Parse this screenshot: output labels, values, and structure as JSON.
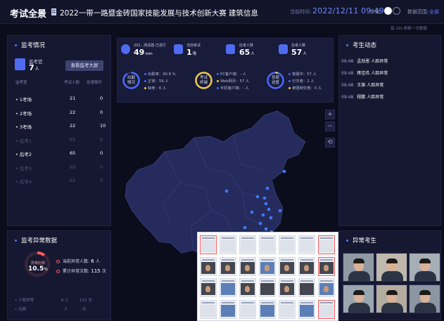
{
  "header": {
    "title": "考试全景",
    "subtitle": "2022一带一路暨金砖国家技能发展与技术创新大赛 建筑信息",
    "time_label": "当前时间:",
    "time": "2022/12/11 09:49",
    "theme_label": "外观:",
    "range_label": "数据范围:",
    "range_link": "全部",
    "refresh_note": "每 10s 刷新一次数据"
  },
  "proctor_panel": {
    "title": "监考情况",
    "proctor_label": "监考官",
    "proctor_count": "7",
    "proctor_unit": "人",
    "wall_button": "查看监考大屏",
    "columns": [
      "监考室",
      "考试人数",
      "处理事件"
    ],
    "rooms": [
      {
        "name": "• 1考场",
        "count": "21",
        "events": "0",
        "active": true
      },
      {
        "name": "• 2考场",
        "count": "22",
        "events": "0",
        "active": true
      },
      {
        "name": "• 3考场",
        "count": "22",
        "events": "10",
        "active": true
      },
      {
        "name": "• 后考1",
        "count": "65",
        "events": "0",
        "active": false
      },
      {
        "name": "• 后考2",
        "count": "65",
        "events": "0",
        "active": true
      },
      {
        "name": "• 后考3",
        "count": "65",
        "events": "0",
        "active": false
      },
      {
        "name": "• 后考4",
        "count": "65",
        "events": "0",
        "active": false
      }
    ]
  },
  "anomaly_panel": {
    "title": "监考异常数据",
    "ring_label": "异常比例",
    "ring_value": "10.5",
    "ring_unit": "%",
    "ring_fraction": 0.105,
    "current_label": "当前异常人数:",
    "current_value": "6",
    "current_unit": "人",
    "total_label": "累计异常次数:",
    "total_value": "115",
    "total_unit": "次",
    "rows": [
      {
        "label": "• 人脸异常",
        "a": "6 人",
        "b": "115 次"
      },
      {
        "label": "• 切屏",
        "a": "- 人",
        "b": "- 次"
      }
    ]
  },
  "stats": {
    "exam_label": "202...测试题 已进行",
    "exam_value": "49",
    "exam_unit": "min",
    "current_exam_label": "当前考试",
    "current_exam_value": "1",
    "current_exam_unit": "场",
    "candidates_label": "应考人数",
    "candidates_value": "65",
    "candidates_unit": "人",
    "present_label": "在考人数",
    "present_value": "57",
    "present_unit": "人",
    "gauge1": {
      "text1": "出勤",
      "text2": "情况",
      "fraction": 0.908
    },
    "gauge1_lines": [
      "出勤率：90.8 %",
      "正常：59 人",
      "缺考：6 人"
    ],
    "gauge2": {
      "text1": "考试",
      "text2": "终端",
      "fraction": 1.0
    },
    "gauge2_lines": [
      "PC客户端：- 人",
      "Web网页：57 人",
      "手机客户端：- 人"
    ],
    "gauge3": {
      "text1": "答题",
      "text2": "进度",
      "fraction": 0.05
    },
    "gauge3_lines": [
      "答题中：57 人",
      "已交卷：2 人",
      "被强制交卷：0 人"
    ]
  },
  "map_controls": [
    "+",
    "−",
    "⟲"
  ],
  "dynamics_panel": {
    "title": "考生动态",
    "items": [
      {
        "time": "09:48",
        "text": "孟劲恩 人脸异常"
      },
      {
        "time": "09:48",
        "text": "蒋佳伟 人脸异常"
      },
      {
        "time": "09:48",
        "text": "王旗 人脸异常"
      },
      {
        "time": "09:48",
        "text": "程鹏 人脸异常"
      }
    ]
  },
  "abnormal_panel": {
    "title": "异常考生"
  },
  "colors": {
    "accent": "#4f7cff",
    "danger": "#ff5d5d",
    "gauge_blue": "#4a6bff",
    "gauge_yellow": "#f2c94c"
  }
}
